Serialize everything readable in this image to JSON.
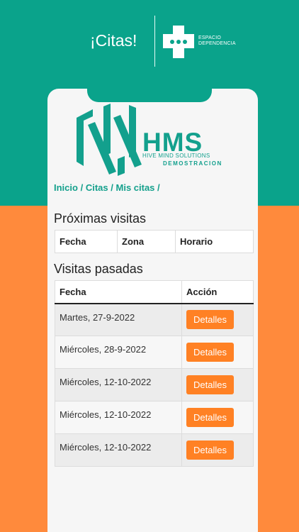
{
  "header": {
    "title": "¡Citas!",
    "brand_line1": "ESPACIO",
    "brand_line2": "DEPENDENCIA"
  },
  "logo": {
    "hms": "HMS",
    "subtitle": "HIVE MIND SOLUTIONS",
    "demo": "DEMOSTRACION"
  },
  "breadcrumb": {
    "inicio": "Inicio",
    "citas": "Citas",
    "mis_citas": "Mis citas",
    "separator": "/"
  },
  "upcoming": {
    "title": "Próximas visitas",
    "columns": [
      "Fecha",
      "Zona",
      "Horario"
    ]
  },
  "past": {
    "title": "Visitas pasadas",
    "columns": [
      "Fecha",
      "Acción"
    ],
    "rows": [
      {
        "date": "Martes, 27-9-2022",
        "action": "Detalles"
      },
      {
        "date": "Miércoles, 28-9-2022",
        "action": "Detalles"
      },
      {
        "date": "Miércoles, 12-10-2022",
        "action": "Detalles"
      },
      {
        "date": "Miércoles, 12-10-2022",
        "action": "Detalles"
      },
      {
        "date": "Miércoles, 12-10-2022",
        "action": "Detalles"
      }
    ]
  },
  "colors": {
    "teal": "#0aa38b",
    "orange": "#ff8a3c",
    "button": "#ff8124"
  }
}
